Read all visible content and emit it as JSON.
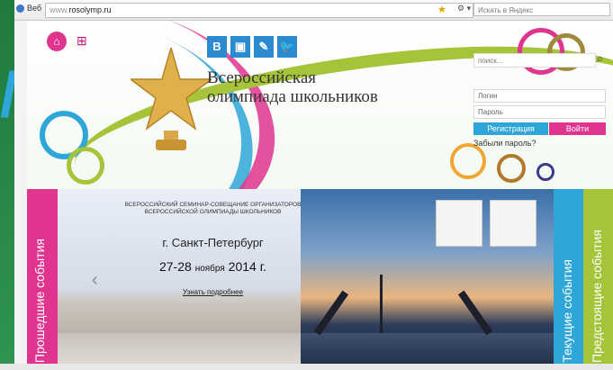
{
  "browser": {
    "tab_label": "Веб",
    "url_prefix": "www.",
    "url_domain": "rosolymp.ru",
    "search_placeholder": "Искать в Яндекс"
  },
  "site": {
    "title_line1": "Всероссийская",
    "title_line2": "олимпиада школьников",
    "social": [
      {
        "label": "B",
        "icon": "vk-icon",
        "color": "#2a8bd0"
      },
      {
        "label": "▣",
        "icon": "instagram-icon",
        "color": "#2a8bd0"
      },
      {
        "label": "✎",
        "icon": "livejournal-icon",
        "color": "#2a8bd0"
      },
      {
        "label": "🐦",
        "icon": "twitter-icon",
        "color": "#2a8bd0"
      }
    ],
    "search_placeholder": "поиск...",
    "login_placeholder": "Логин",
    "password_placeholder": "Пароль",
    "register_label": "Регистрация",
    "enter_label": "Войти",
    "forgot_label": "Забыли пароль?"
  },
  "slider": {
    "seminar_text": "ВСЕРОССИЙСКИЙ СЕМИНАР-СОВЕЩАНИЕ ОРГАНИЗАТОРОВ ВСЕРОССИЙСКОЙ ОЛИМПИАДЫ ШКОЛЬНИКОВ",
    "city": "г. Санкт-Петербург",
    "dates_main": "27-28",
    "dates_month": "ноября",
    "dates_year": "2014 г.",
    "more_link": "Узнать подробнее"
  },
  "sidebars": {
    "past": "Прошедшие события",
    "current": "Текущие события",
    "upcoming": "Предстоящие события"
  },
  "colors": {
    "pink": "#e0358f",
    "blue": "#2ea7d8",
    "green": "#a5c43a",
    "brown": "#b07a2a"
  }
}
